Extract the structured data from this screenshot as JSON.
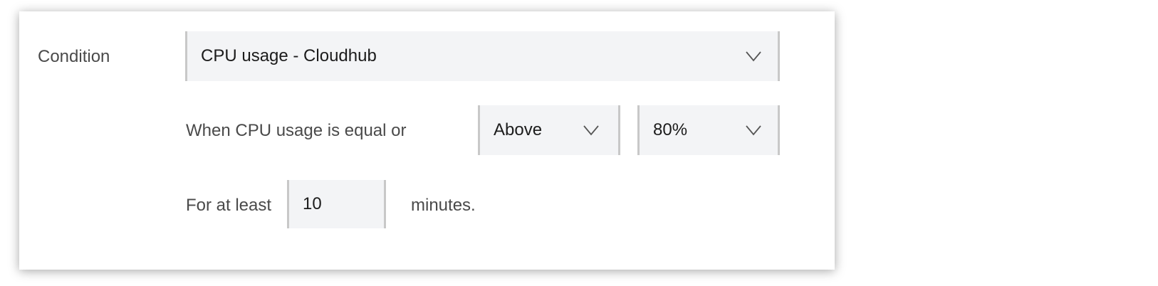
{
  "condition": {
    "label": "Condition",
    "selected": "CPU usage - Cloudhub",
    "chevron_icon": "chevron-down-icon"
  },
  "threshold": {
    "prefix": "When CPU usage is equal or",
    "operator": "Above",
    "value": "80%"
  },
  "duration": {
    "prefix": "For at least",
    "value": "10",
    "suffix": "minutes."
  },
  "colors": {
    "field_bg": "#f3f4f6",
    "field_border": "#c8c8c8",
    "label_text": "#4a4a4a",
    "value_text": "#1c1c1c"
  }
}
